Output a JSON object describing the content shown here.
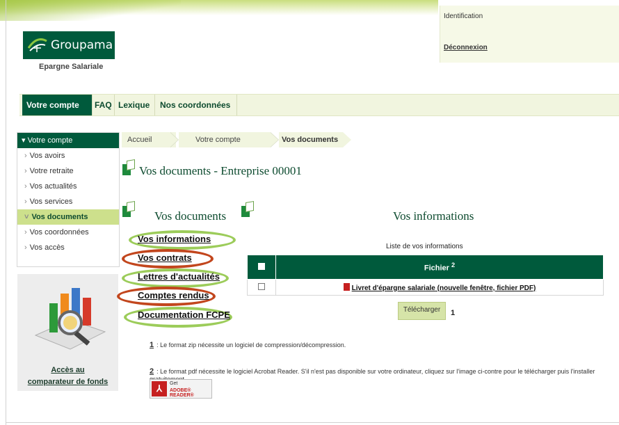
{
  "header": {
    "brand": "Groupama",
    "brand_sub": "Epargne Salariale",
    "identification": "Identification",
    "logout": "Déconnexion"
  },
  "nav": {
    "items": [
      "Votre compte",
      "FAQ",
      "Lexique",
      "Nos coordonnées"
    ],
    "active": "Votre compte"
  },
  "sidebar": {
    "head": "Votre compte",
    "items": [
      "Vos avoirs",
      "Votre retraite",
      "Vos actualités",
      "Vos services",
      "Vos documents",
      "Vos coordonnées",
      "Vos accès"
    ],
    "active": "Vos documents"
  },
  "comparateur": {
    "line1": "Accès au",
    "line2": "comparateur de fonds"
  },
  "breadcrumb": [
    "Accueil",
    "Votre compte",
    "Vos documents"
  ],
  "page_title": "Vos documents - Entreprise 00001",
  "documents": {
    "title": "Vos documents",
    "links": [
      "Vos informations",
      "Vos contrats",
      "Lettres d'actualités",
      "Comptes rendus",
      "Documentation FCPE"
    ]
  },
  "informations": {
    "title": "Vos informations",
    "list_caption": "Liste de vos informations",
    "column_header": "Fichier",
    "column_sup": "2",
    "rows": [
      {
        "file": "Livret d'épargne salariale (nouvelle fenêtre, fichier PDF)"
      }
    ],
    "download_button": "Télécharger",
    "download_note": "1"
  },
  "notes": {
    "n1_num": "1",
    "n1": ": Le format zip nécessite un logiciel de compression/décompression.",
    "n2_num": "2",
    "n2": ": Le format pdf nécessite le logiciel Acrobat Reader. S'il n'est pas disponible sur votre ordinateur, cliquez sur l'image ci-contre pour le télécharger puis l'installer gratuitement."
  },
  "adobe": {
    "get": "Get",
    "reader": "ADOBE® READER®"
  },
  "colors": {
    "brand_green": "#005a3c",
    "light_green": "#cde08c",
    "ring_green": "#9ccc5a",
    "ring_red": "#c2461d"
  }
}
